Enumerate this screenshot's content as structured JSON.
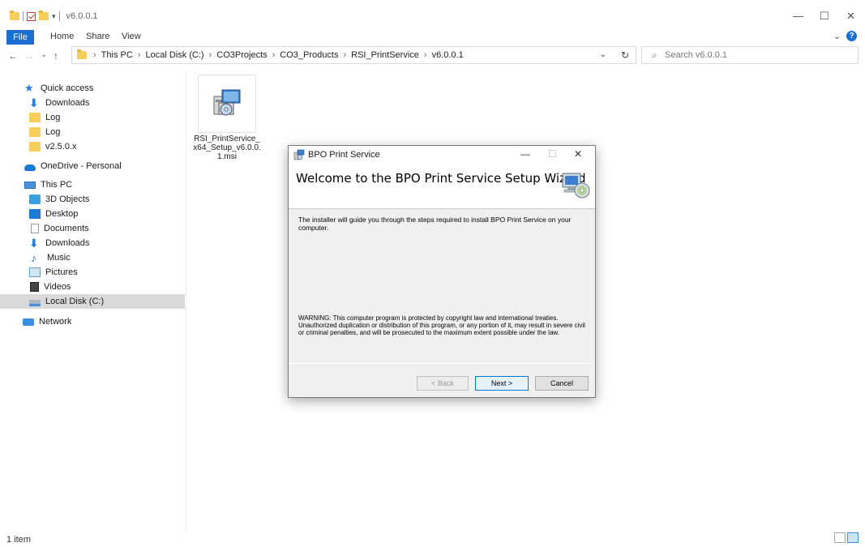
{
  "window": {
    "title": "v6.0.0.1",
    "minimize": "—",
    "maximize": "☐",
    "close": "✕"
  },
  "ribbon": {
    "tabs": [
      "File",
      "Home",
      "Share",
      "View"
    ],
    "collapse": "⌄",
    "help": "?"
  },
  "address": {
    "back": "←",
    "forward": "→",
    "recent": "⌄",
    "up": "↑",
    "crumbs": [
      "This PC",
      "Local Disk (C:)",
      "CO3Projects",
      "CO3_Products",
      "RSI_PrintService",
      "v6.0.0.1"
    ],
    "separator": "›",
    "dropdown": "⌄",
    "refresh": "↻"
  },
  "search": {
    "placeholder": "Search v6.0.0.1"
  },
  "nav": {
    "items": [
      {
        "label": "Quick access",
        "icon": "star-icon"
      },
      {
        "label": "Downloads",
        "icon": "download-icon"
      },
      {
        "label": "Log",
        "icon": "folder-icon"
      },
      {
        "label": "Log",
        "icon": "folder-icon"
      },
      {
        "label": "v2.5.0.x",
        "icon": "folder-icon"
      },
      {
        "label": "OneDrive - Personal",
        "icon": "cloud-icon"
      },
      {
        "label": "This PC",
        "icon": "computer-icon"
      },
      {
        "label": "3D Objects",
        "icon": "cube-icon"
      },
      {
        "label": "Desktop",
        "icon": "desktop-icon"
      },
      {
        "label": "Documents",
        "icon": "document-icon"
      },
      {
        "label": "Downloads",
        "icon": "download-icon"
      },
      {
        "label": "Music",
        "icon": "music-icon"
      },
      {
        "label": "Pictures",
        "icon": "pictures-icon"
      },
      {
        "label": "Videos",
        "icon": "video-icon"
      },
      {
        "label": "Local Disk (C:)",
        "icon": "disk-icon"
      },
      {
        "label": "Network",
        "icon": "network-icon"
      }
    ],
    "selected": "Local Disk (C:)"
  },
  "files": [
    {
      "name_line1": "RSI_PrintService_",
      "name_line2": "x64_Setup_v6.0.0.",
      "name_line3": "1.msi",
      "icon": "msi-installer-icon"
    }
  ],
  "status": {
    "count": "1 item"
  },
  "dialog": {
    "title": "BPO Print Service",
    "heading": "Welcome to the BPO Print Service Setup Wizard",
    "body": "The installer will guide you through the steps required to install BPO Print Service on your computer.",
    "warning": "WARNING: This computer program is protected by copyright law and international treaties. Unauthorized duplication or distribution of this program, or any portion of it, may result in severe civil or criminal penalties, and will be prosecuted to the maximum extent possible under the law.",
    "back_label": "< Back",
    "next_label": "Next >",
    "cancel_label": "Cancel",
    "minimize": "—",
    "maximize": "☐",
    "close": "✕"
  },
  "colors": {
    "accent": "#1a6fd1",
    "folder": "#f5cf5a",
    "selection": "#d9d9d9"
  }
}
